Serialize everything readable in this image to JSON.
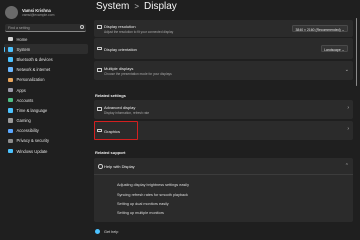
{
  "user": {
    "name": "Vamsi Krishna",
    "email": "vamsi@example.com"
  },
  "search": {
    "placeholder": "Find a setting"
  },
  "nav": {
    "items": [
      {
        "label": "Home",
        "icon": "home-icon",
        "color": "#d6d6d6"
      },
      {
        "label": "System",
        "icon": "system-icon",
        "color": "#4cc2ff",
        "active": true
      },
      {
        "label": "Bluetooth & devices",
        "icon": "bluetooth-icon",
        "color": "#4cc2ff"
      },
      {
        "label": "Network & internet",
        "icon": "network-icon",
        "color": "#6bb8ff"
      },
      {
        "label": "Personalization",
        "icon": "brush-icon",
        "color": "#e8a55c"
      },
      {
        "label": "Apps",
        "icon": "apps-icon",
        "color": "#9a9aa8"
      },
      {
        "label": "Accounts",
        "icon": "accounts-icon",
        "color": "#4fbf85"
      },
      {
        "label": "Time & language",
        "icon": "clock-icon",
        "color": "#4cc2ff"
      },
      {
        "label": "Gaming",
        "icon": "gaming-icon",
        "color": "#9a9a9a"
      },
      {
        "label": "Accessibility",
        "icon": "accessibility-icon",
        "color": "#5aa8ff"
      },
      {
        "label": "Privacy & security",
        "icon": "shield-icon",
        "color": "#8c8c8c"
      },
      {
        "label": "Windows Update",
        "icon": "update-icon",
        "color": "#4cc2ff"
      }
    ]
  },
  "breadcrumb": {
    "parent": "System",
    "separator": ">",
    "current": "Display"
  },
  "settings": {
    "resolution": {
      "title": "Display resolution",
      "subtitle": "Adjust the resolution to fit your connected display",
      "value": "3840 × 2160 (Recommended)"
    },
    "orientation": {
      "title": "Display orientation",
      "value": "Landscape"
    },
    "multiple": {
      "title": "Multiple displays",
      "subtitle": "Choose the presentation mode for your displays"
    }
  },
  "related_settings": {
    "heading": "Related settings",
    "advanced": {
      "title": "Advanced display",
      "subtitle": "Display information, refresh rate"
    },
    "graphics": {
      "title": "Graphics"
    }
  },
  "related_support": {
    "heading": "Related support",
    "help": {
      "title": "Help with Display"
    },
    "links": [
      "Adjusting display brightness settings easily",
      "Syncing refresh rates for smooth playback",
      "Setting up dual monitors easily",
      "Setting up multiple monitors"
    ]
  },
  "footer": {
    "get_help": "Get help"
  }
}
